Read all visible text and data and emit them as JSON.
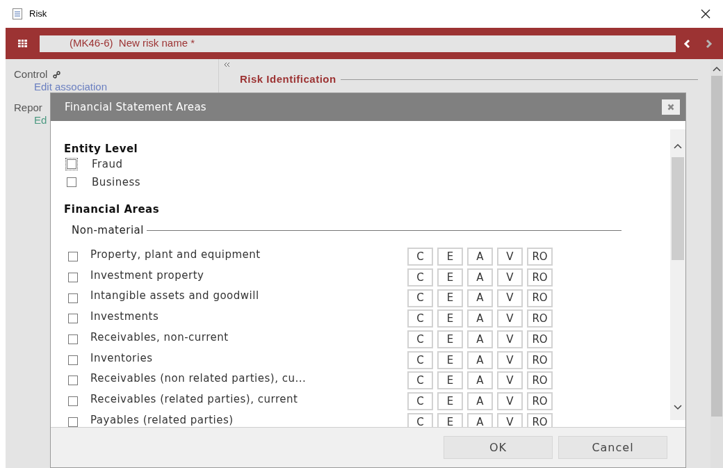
{
  "window": {
    "title": "Risk"
  },
  "toolbar": {
    "record": "(MK46-6)  New risk name *"
  },
  "sidebar": {
    "items": [
      {
        "kind": "header",
        "label": "Control"
      },
      {
        "kind": "link",
        "label": "Edit association"
      },
      {
        "kind": "header",
        "label": "Repor"
      },
      {
        "kind": "link",
        "label": "Ed"
      }
    ]
  },
  "main": {
    "section_title": "Risk Identification"
  },
  "dialog": {
    "title": "Financial Statement Areas",
    "entity_level": {
      "heading": "Entity Level",
      "items": [
        {
          "label": "Fraud",
          "checked": false,
          "focused": true
        },
        {
          "label": "Business",
          "checked": false,
          "focused": false
        }
      ]
    },
    "financial_areas": {
      "heading": "Financial Areas",
      "group": "Non-material",
      "rows": [
        {
          "label": "Property, plant and equipment",
          "checked": false,
          "assertions": [
            "C",
            "E",
            "A",
            "V",
            "RO"
          ]
        },
        {
          "label": "Investment property",
          "checked": false,
          "assertions": [
            "C",
            "E",
            "A",
            "V",
            "RO"
          ]
        },
        {
          "label": "Intangible assets and goodwill",
          "checked": false,
          "assertions": [
            "C",
            "E",
            "A",
            "V",
            "RO"
          ]
        },
        {
          "label": "Investments",
          "checked": false,
          "assertions": [
            "C",
            "E",
            "A",
            "V",
            "RO"
          ]
        },
        {
          "label": "Receivables, non-current",
          "checked": false,
          "assertions": [
            "C",
            "E",
            "A",
            "V",
            "RO"
          ]
        },
        {
          "label": "Inventories",
          "checked": false,
          "assertions": [
            "C",
            "E",
            "A",
            "V",
            "RO"
          ]
        },
        {
          "label": "Receivables (non related parties), cu...",
          "checked": false,
          "assertions": [
            "C",
            "E",
            "A",
            "V",
            "RO"
          ]
        },
        {
          "label": "Receivables (related parties), current",
          "checked": false,
          "assertions": [
            "C",
            "E",
            "A",
            "V",
            "RO"
          ]
        },
        {
          "label": "Payables (related parties)",
          "checked": false,
          "assertions": [
            "C",
            "E",
            "A",
            "V",
            "RO"
          ]
        }
      ]
    },
    "buttons": [
      "OK",
      "Cancel"
    ]
  }
}
